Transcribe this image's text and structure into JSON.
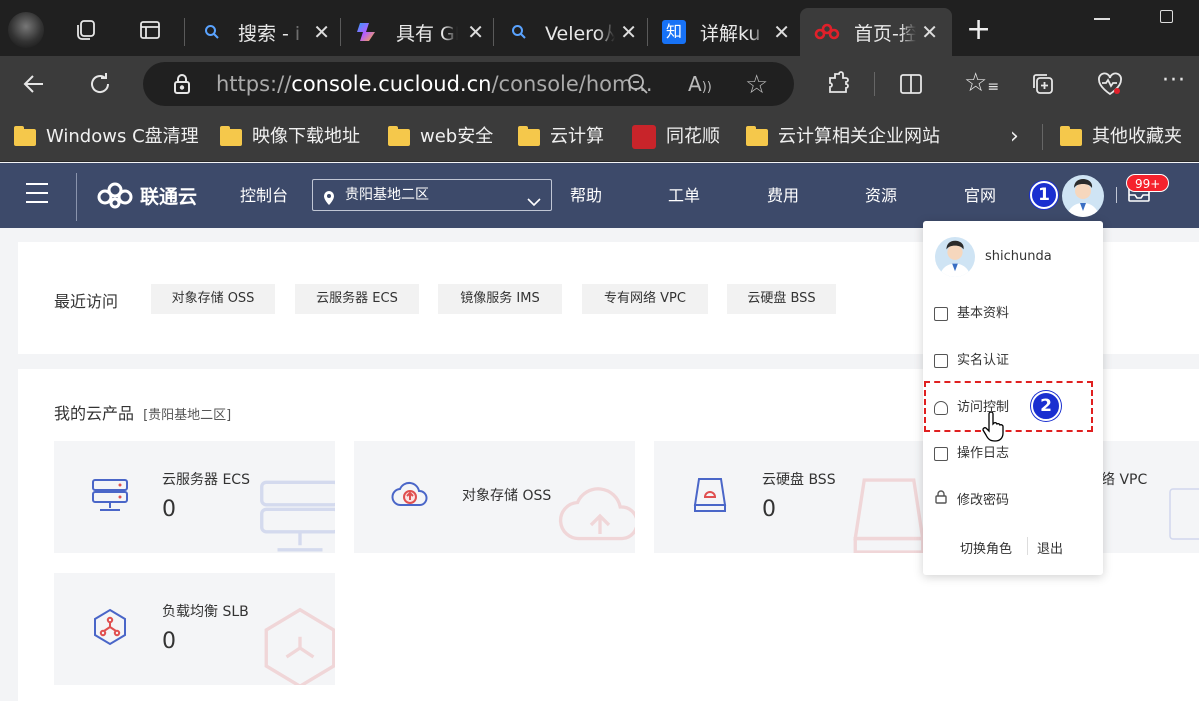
{
  "browser": {
    "tabs": [
      {
        "title": "搜索 - i"
      },
      {
        "title": "具有 GI"
      },
      {
        "title": "Velero从"
      },
      {
        "title": "详解ku"
      },
      {
        "title": "首页-控"
      }
    ],
    "url_prefix": "https://",
    "url_domain": "console.cucloud.cn",
    "url_path": "/console/hom...",
    "bookmarks": [
      "Windows C盘清理",
      "映像下载地址",
      "web安全",
      "云计算",
      "同花顺",
      "云计算相关企业网站"
    ],
    "other_bookmarks": "其他收藏夹",
    "zhihu_icon": "知"
  },
  "header": {
    "logo": "联通云",
    "console": "控制台",
    "region": "贵阳基地二区",
    "nav": [
      "帮助",
      "工单",
      "费用",
      "资源",
      "官网"
    ],
    "notif_badge": "99+"
  },
  "recent": {
    "label": "最近访问",
    "items": [
      "对象存储 OSS",
      "云服务器 ECS",
      "镜像服务 IMS",
      "专有网络 VPC",
      "云硬盘 BSS"
    ]
  },
  "products": {
    "title": "我的云产品",
    "region": "[贵阳基地二区]",
    "items": [
      {
        "name": "云服务器 ECS",
        "count": "0"
      },
      {
        "name": "对象存储 OSS",
        "count": ""
      },
      {
        "name": "云硬盘 BSS",
        "count": "0"
      },
      {
        "name": "络 VPC",
        "count": ""
      },
      {
        "name": "负载均衡 SLB",
        "count": "0"
      }
    ]
  },
  "menu": {
    "username": "shichunda",
    "items": [
      "基本资料",
      "实名认证",
      "访问控制",
      "操作日志",
      "修改密码"
    ],
    "switch_role": "切换角色",
    "logout": "退出"
  },
  "annotations": {
    "step1": "1",
    "step2": "2",
    "highlight_color": "#e02020",
    "badge_color": "#1a2fd0"
  }
}
